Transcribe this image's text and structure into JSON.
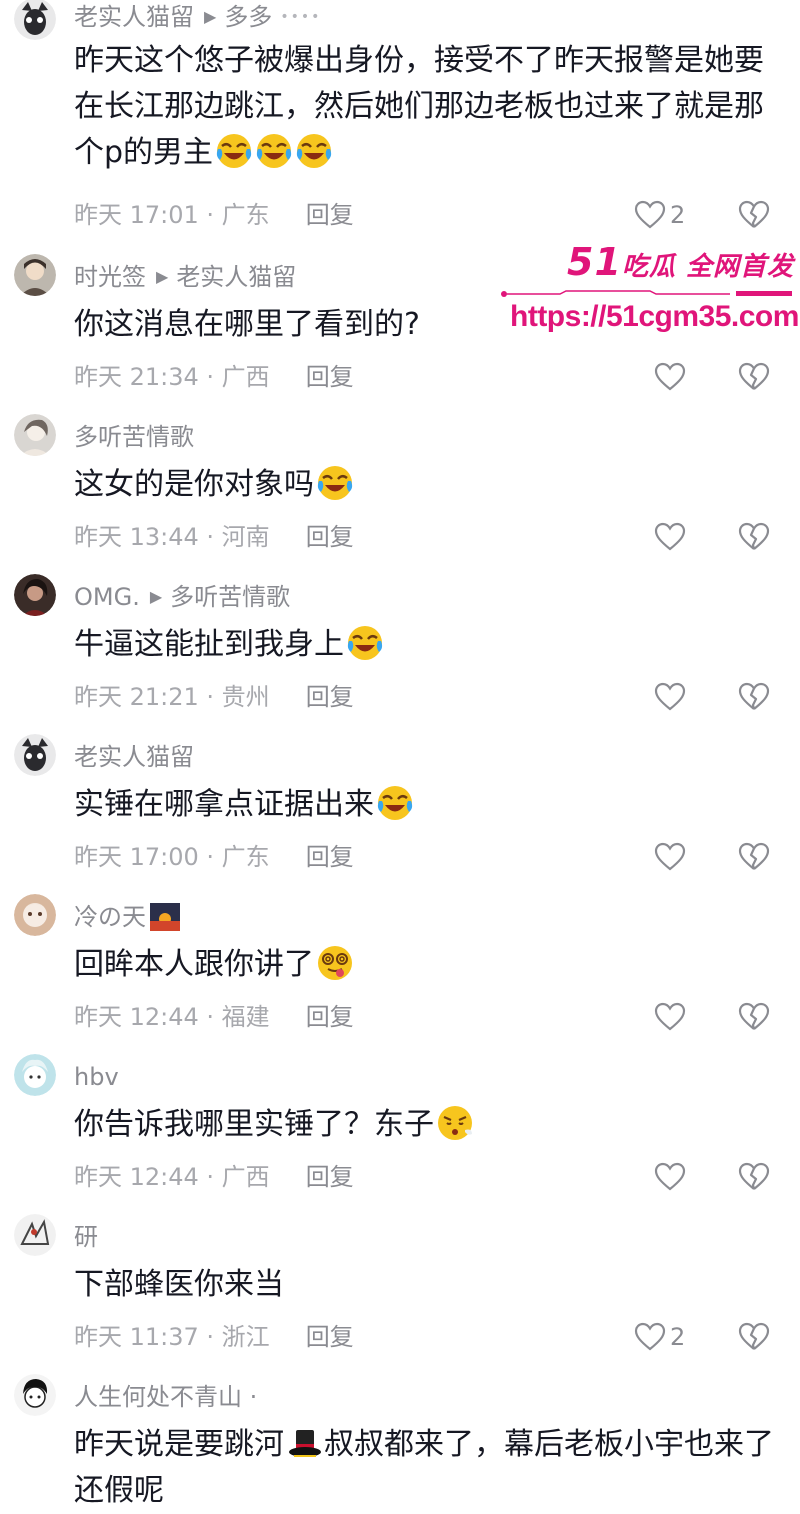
{
  "reply_label": "回复",
  "comments": [
    {
      "name": "老实人猫留",
      "reply_to": "多多",
      "more": "••••",
      "text": "昨天这个悠子被爆出身份，接受不了昨天报警是她要在长江那边跳江，然后她们那边老板也过来了就是那个p的男主",
      "time": "昨天 17:01 · 广东",
      "likes": "2",
      "emoji": [
        "laugh-cry-emoji",
        "laugh-cry-emoji",
        "laugh-cry-emoji"
      ]
    },
    {
      "name": "时光签",
      "reply_to": "老实人猫留",
      "text": "你这消息在哪里了看到的?",
      "time": "昨天 21:34 · 广西",
      "likes": ""
    },
    {
      "name": "多听苦情歌",
      "reply_to": "",
      "text": "这女的是你对象吗",
      "time": "昨天 13:44 · 河南",
      "likes": "",
      "emoji": [
        "laugh-cry-emoji"
      ]
    },
    {
      "name": "OMG.",
      "reply_to": "多听苦情歌",
      "text": "牛逼这能扯到我身上",
      "time": "昨天 21:21 · 贵州",
      "likes": "",
      "emoji": [
        "laugh-cry-emoji"
      ]
    },
    {
      "name": "老实人猫留",
      "reply_to": "",
      "text": "实锤在哪拿点证据出来",
      "time": "昨天 17:00 · 广东",
      "likes": "",
      "emoji": [
        "laugh-cry-emoji"
      ]
    },
    {
      "name": "冷の天",
      "reply_to": "",
      "text": "回眸本人跟你讲了",
      "time": "昨天 12:44 · 福建",
      "likes": "",
      "emoji": [
        "dizzy-tongue-emoji"
      ]
    },
    {
      "name": "hbv",
      "reply_to": "",
      "text": "你告诉我哪里实锤了？东子",
      "time": "昨天 12:44 · 广西",
      "likes": "",
      "emoji": [
        "huff-emoji"
      ]
    },
    {
      "name": "研",
      "reply_to": "",
      "text": "下部蜂医你来当",
      "time": "昨天 11:37 · 浙江",
      "likes": "2"
    },
    {
      "name": "人生何处不青山 ·",
      "reply_to": "",
      "text_a": "昨天说是要跳河",
      "text_b": "叔叔都来了，幕后老板小宇也来了还假呢",
      "emoji": [
        "top-hat-emoji"
      ]
    }
  ],
  "watermark": {
    "brand_num": "51",
    "brand_text": "吃瓜 全网首发",
    "url": "https://51cgm35.com"
  },
  "colors": {
    "accent": "#e0157a",
    "meta": "#a7a8ad",
    "name": "#8a8b91",
    "text": "#161823"
  }
}
